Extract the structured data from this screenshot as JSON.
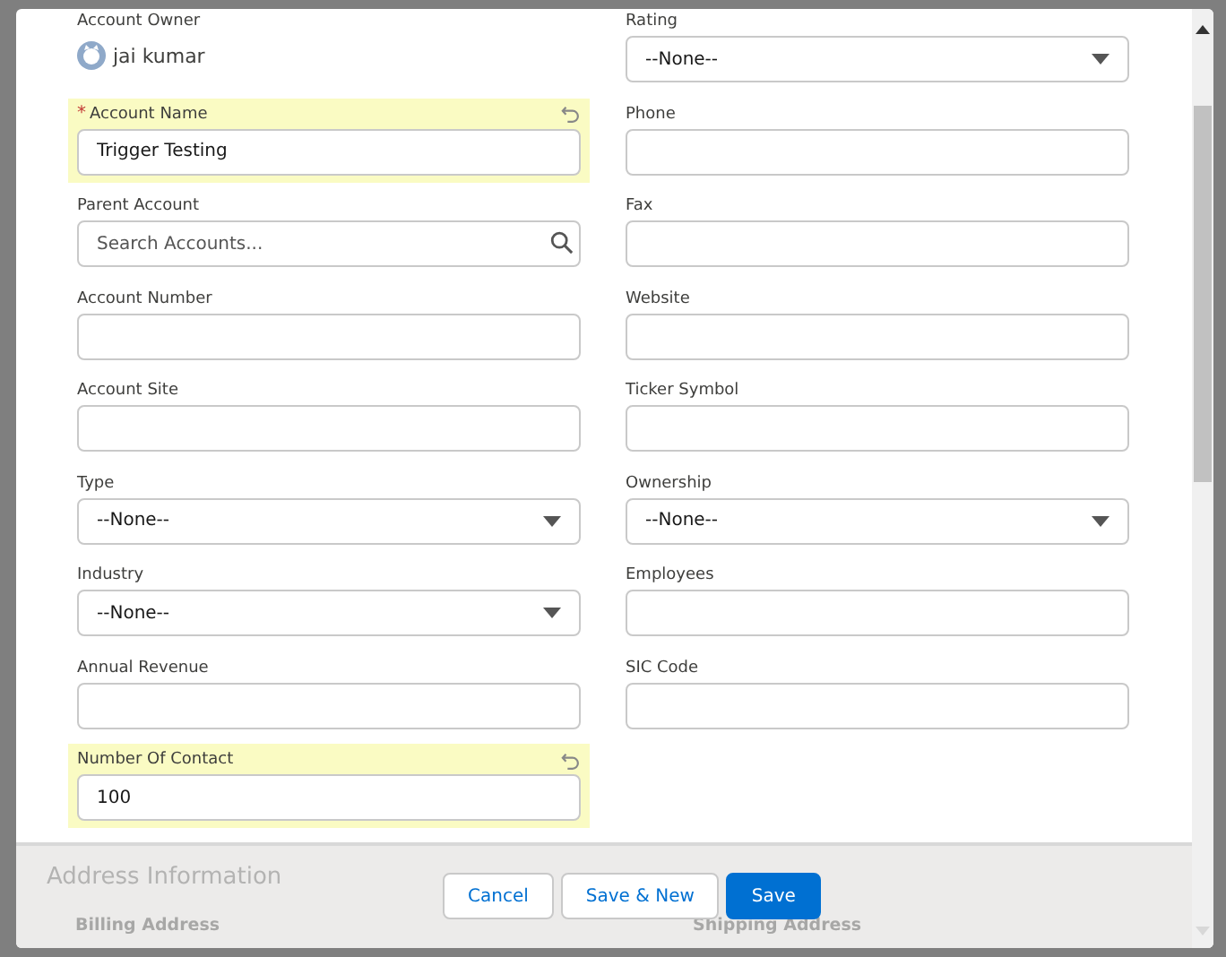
{
  "fields": [
    {
      "kind": "owner",
      "label": "Account Owner",
      "value": "jai kumar",
      "required": false,
      "changed": false
    },
    {
      "kind": "picklist",
      "label": "Rating",
      "value": "--None--",
      "required": false,
      "changed": false
    },
    {
      "kind": "text",
      "label": "Account Name",
      "value": "Trigger Testing",
      "required": true,
      "required_marker": "*",
      "changed": true
    },
    {
      "kind": "text",
      "label": "Phone",
      "required": false,
      "changed": false
    },
    {
      "kind": "lookup",
      "label": "Parent Account",
      "placeholder": "Search Accounts...",
      "required": false,
      "changed": false
    },
    {
      "kind": "text",
      "label": "Fax",
      "required": false,
      "changed": false
    },
    {
      "kind": "text",
      "label": "Account Number",
      "required": false,
      "changed": false
    },
    {
      "kind": "text",
      "label": "Website",
      "required": false,
      "changed": false
    },
    {
      "kind": "text",
      "label": "Account Site",
      "required": false,
      "changed": false
    },
    {
      "kind": "text",
      "label": "Ticker Symbol",
      "required": false,
      "changed": false
    },
    {
      "kind": "picklist",
      "label": "Type",
      "value": "--None--",
      "required": false,
      "changed": false
    },
    {
      "kind": "picklist",
      "label": "Ownership",
      "value": "--None--",
      "required": false,
      "changed": false
    },
    {
      "kind": "picklist",
      "label": "Industry",
      "value": "--None--",
      "required": false,
      "changed": false
    },
    {
      "kind": "text",
      "label": "Employees",
      "required": false,
      "changed": false
    },
    {
      "kind": "text",
      "label": "Annual Revenue",
      "required": false,
      "changed": false
    },
    {
      "kind": "text",
      "label": "SIC Code",
      "required": false,
      "changed": false
    },
    {
      "kind": "text",
      "label": "Number Of Contact",
      "value": "100",
      "required": false,
      "changed": true
    }
  ],
  "behind_footer": {
    "section_title": "Address Information",
    "billing_label": "Billing Address",
    "shipping_label": "Shipping Address"
  },
  "buttons": [
    {
      "label": "Cancel",
      "kind": "neutral"
    },
    {
      "label": "Save & New",
      "kind": "neutral"
    },
    {
      "label": "Save",
      "kind": "brand"
    }
  ]
}
